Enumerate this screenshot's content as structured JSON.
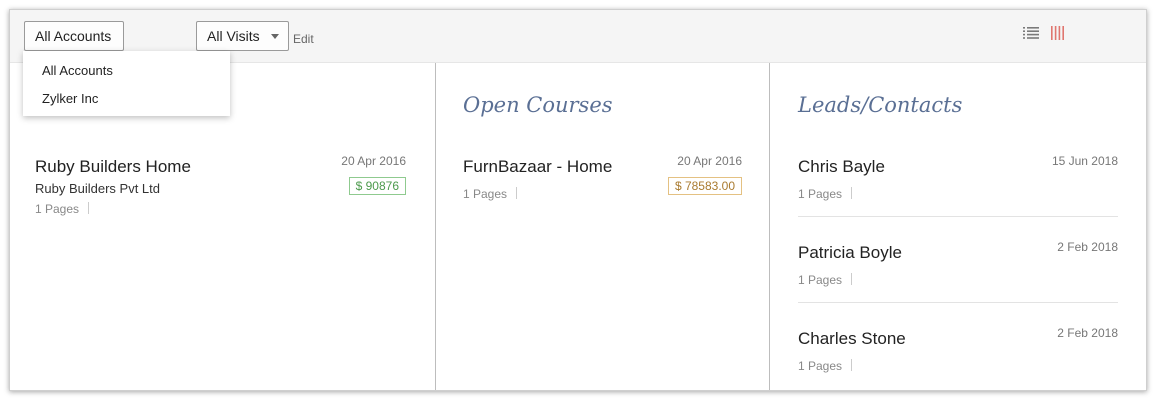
{
  "toolbar": {
    "accounts_label": "All Accounts",
    "visits_label": "All Visits",
    "edit_label": "Edit",
    "list_view_icon": "list-view-icon",
    "column_view_icon": "column-view-icon"
  },
  "dropdown": {
    "items": [
      {
        "label": "All Accounts"
      },
      {
        "label": "Zylker Inc"
      }
    ]
  },
  "columns": [
    {
      "title": "",
      "cards": [
        {
          "name": "Ruby Builders Home",
          "date": "20 Apr 2016",
          "subtitle": "Ruby Builders Pvt Ltd",
          "amount": "$ 90876",
          "pages": "1 Pages"
        }
      ]
    },
    {
      "title": "Open Courses",
      "cards": [
        {
          "name": "FurnBazaar - Home",
          "date": "20 Apr 2016",
          "amount": "$ 78583.00",
          "pages": "1 Pages"
        }
      ]
    },
    {
      "title": "Leads/Contacts",
      "cards": [
        {
          "name": "Chris Bayle",
          "date": "15 Jun 2018",
          "pages": "1 Pages"
        },
        {
          "name": "Patricia Boyle",
          "date": "2 Feb 2018",
          "pages": "1 Pages"
        },
        {
          "name": "Charles Stone",
          "date": "2 Feb 2018",
          "pages": "1 Pages"
        }
      ]
    }
  ],
  "colors": {
    "title": "#5a6f94",
    "amount_green": "#4c9a4c",
    "amount_orange": "#a97a2f",
    "column_view_active": "#e0766f"
  }
}
